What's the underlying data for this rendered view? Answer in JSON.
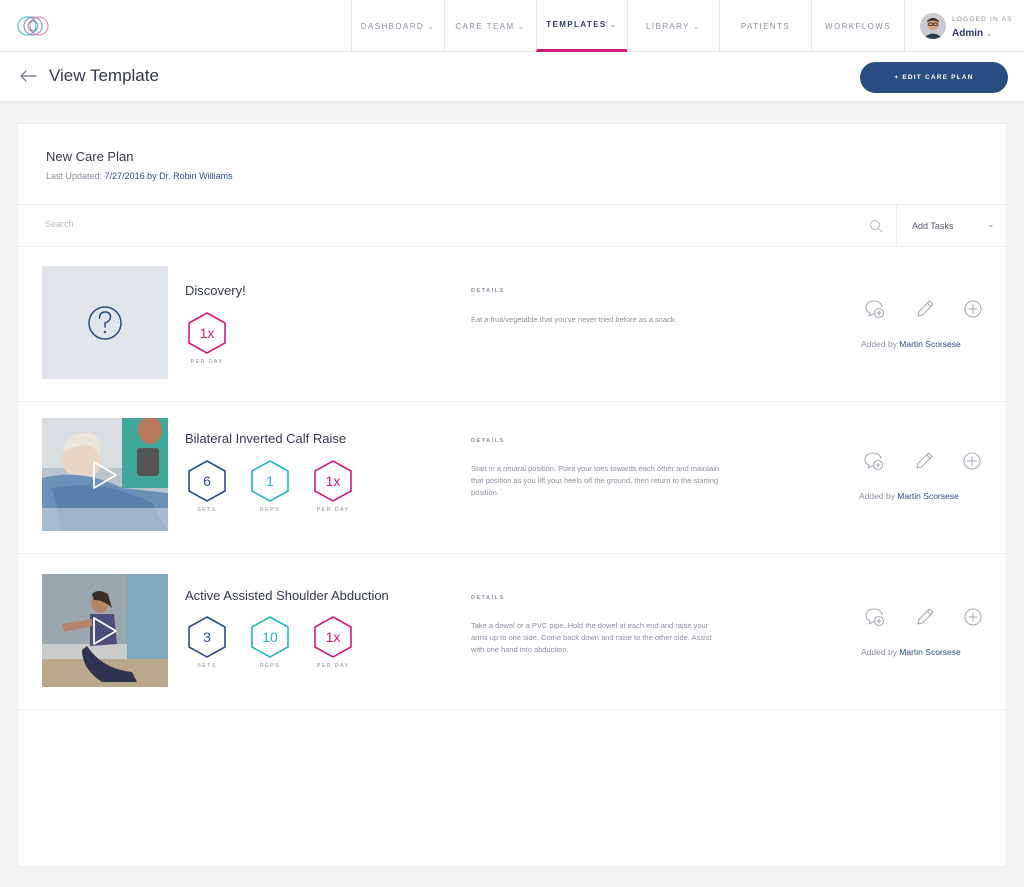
{
  "nav": {
    "items": [
      {
        "label": "Dashboard",
        "chevron": true,
        "active": false
      },
      {
        "label": "Care Team",
        "chevron": true,
        "active": false
      },
      {
        "label": "Templates",
        "chevron": true,
        "active": true
      },
      {
        "label": "Library",
        "chevron": true,
        "active": false
      },
      {
        "label": "Patients",
        "chevron": false,
        "active": false
      },
      {
        "label": "Workflows",
        "chevron": false,
        "active": false
      }
    ],
    "user": {
      "logged_in_label": "Logged in as",
      "name": "Admin"
    }
  },
  "header": {
    "title": "View Template",
    "edit_button_label": "+ Edit Care Plan"
  },
  "plan": {
    "title": "New Care Plan",
    "last_updated_label": "Last Updated:",
    "last_updated_value": "7/27/2016 by Dr. Robin Williams"
  },
  "search": {
    "placeholder": "Search",
    "add_tasks_label": "Add Tasks"
  },
  "tasks": [
    {
      "title": "Discovery!",
      "thumbnail": "question-placeholder",
      "metrics": [
        {
          "value": "1x",
          "label": "Per Day",
          "color": "#d11a78"
        }
      ],
      "details_label": "Details",
      "details": "Eat a fruit/vegetable that you've never tried before as a snack.",
      "added_by_label": "Added by",
      "added_by": "Martin Scorsese"
    },
    {
      "title": "Bilateral Inverted Calf Raise",
      "thumbnail": "video-calf-raise",
      "metrics": [
        {
          "value": "6",
          "label": "Sets",
          "color": "#2b4e82"
        },
        {
          "value": "1",
          "label": "Reps",
          "color": "#1fb8b8"
        },
        {
          "value": "1x",
          "label": "Per Day",
          "color": "#d11a78"
        }
      ],
      "details_label": "Details",
      "details": "Start in a neutral position. Point your toes towards each other and maintain that position as you lift your heels off the ground, then return to the starting position.",
      "added_by_label": "Added by",
      "added_by": "Martin Scorsese"
    },
    {
      "title": "Active Assisted Shoulder Abduction",
      "thumbnail": "video-shoulder-abduction",
      "metrics": [
        {
          "value": "3",
          "label": "Sets",
          "color": "#2b4e82"
        },
        {
          "value": "10",
          "label": "Reps",
          "color": "#1fb8b8"
        },
        {
          "value": "1x",
          "label": "Per Day",
          "color": "#d11a78"
        }
      ],
      "details_label": "Details",
      "details": "Take a dowel or a PVC pipe. Hold the dowel at each end and raise your arms up to one side. Come back down and raise to the other side. Assist with one hand into abduction.",
      "added_by_label": "Added by",
      "added_by": "Martin Scorsese"
    }
  ],
  "colors": {
    "accent": "#d11a78",
    "primary": "#2b4e82",
    "teal": "#1fb8b8"
  },
  "icons": [
    "logo-icon",
    "chevron-down-icon",
    "back-arrow-icon",
    "search-icon",
    "question-icon",
    "play-icon",
    "comment-add-icon",
    "pencil-icon",
    "plus-circle-icon"
  ]
}
